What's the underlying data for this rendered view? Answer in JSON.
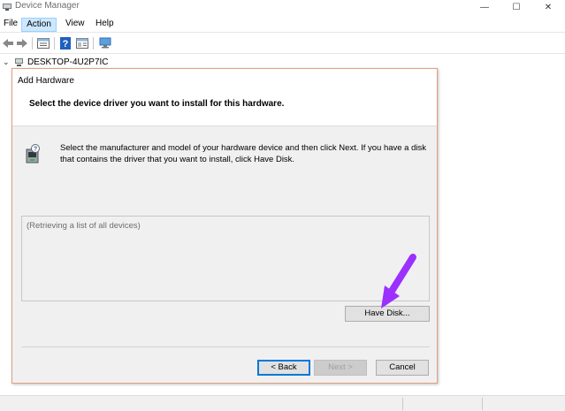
{
  "window": {
    "title": "Device Manager",
    "controls": {
      "minimize": "—",
      "maximize": "☐",
      "close": "✕"
    }
  },
  "menu": {
    "items": [
      {
        "label": "File"
      },
      {
        "label": "Action",
        "active": true
      },
      {
        "label": "View"
      },
      {
        "label": "Help"
      }
    ]
  },
  "toolbar": {
    "icons": [
      "back-arrow-icon",
      "forward-arrow-icon",
      "properties-icon",
      "help-icon",
      "action-pane-icon",
      "monitor-icon"
    ]
  },
  "tree": {
    "root_label": "DESKTOP-4U2P7IC",
    "expand_glyph": "⌄"
  },
  "dialog": {
    "title": "Add Hardware",
    "heading": "Select the device driver you want to install for this hardware.",
    "description": "Select the manufacturer and model of your hardware device and then click Next. If you have a disk that contains the driver that you want to install, click Have Disk.",
    "list_placeholder": "(Retrieving a list of all devices)",
    "buttons": {
      "have_disk": "Have Disk...",
      "back": "< Back",
      "next": "Next >",
      "cancel": "Cancel"
    }
  },
  "colors": {
    "accent": "#0078d7",
    "menu_highlight": "#cce8ff",
    "annotation_arrow": "#9b30ff"
  }
}
